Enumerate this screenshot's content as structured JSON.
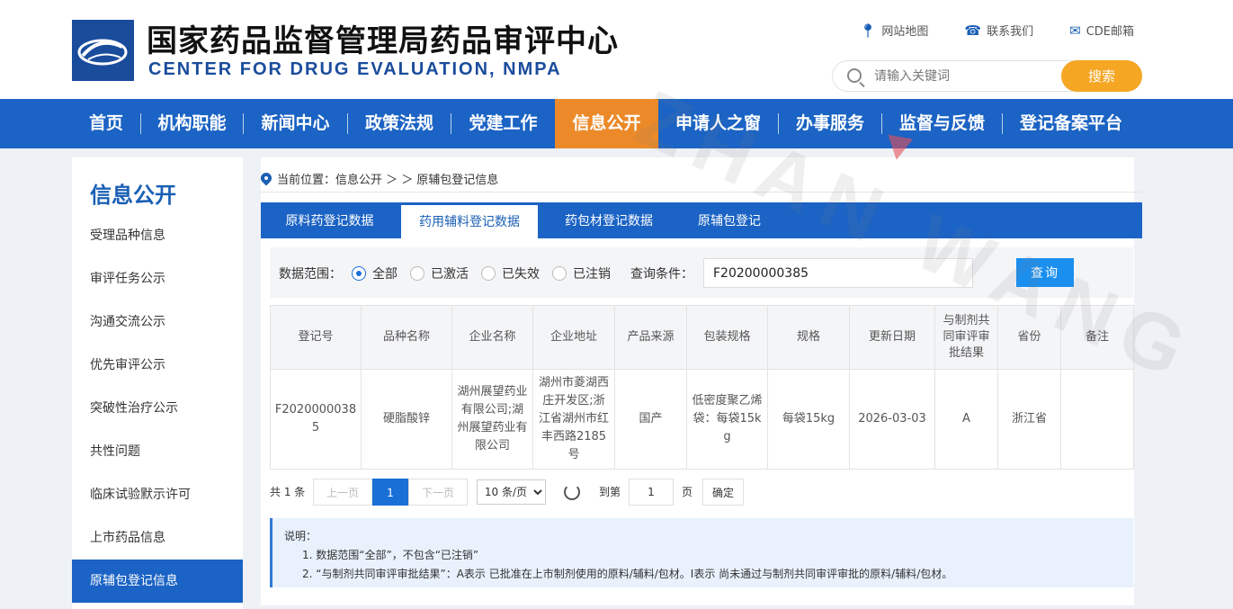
{
  "header": {
    "title_cn": "国家药品监督管理局药品审评中心",
    "title_en": "CENTER FOR DRUG EVALUATION, NMPA",
    "top_links": [
      "网站地图",
      "联系我们",
      "CDE邮箱"
    ],
    "search_placeholder": "请输入关键词",
    "search_button": "搜索"
  },
  "nav": {
    "items": [
      "首页",
      "机构职能",
      "新闻中心",
      "政策法规",
      "党建工作",
      "信息公开",
      "申请人之窗",
      "办事服务",
      "监督与反馈",
      "登记备案平台"
    ],
    "active": "信息公开"
  },
  "watermark": "ZHAN WANG",
  "sidebar": {
    "title": "信息公开",
    "items": [
      "受理品种信息",
      "审评任务公示",
      "沟通交流公示",
      "优先审评公示",
      "突破性治疗公示",
      "共性问题",
      "临床试验默示许可",
      "上市药品信息",
      "原辅包登记信息"
    ],
    "active": "原辅包登记信息"
  },
  "breadcrumb": {
    "prefix": "当前位置：信息公开 ＞ ＞ ",
    "current": "原辅包登记信息"
  },
  "tabs": {
    "items": [
      "原料药登记数据",
      "药用辅料登记数据",
      "药包材登记数据",
      "原辅包登记"
    ],
    "active": "药用辅料登记数据"
  },
  "filter": {
    "range_label": "数据范围：",
    "options": [
      "全部",
      "已激活",
      "已失效",
      "已注销"
    ],
    "selected": "全部",
    "query_label": "查询条件：",
    "query_value": "F20200000385",
    "query_button": "查询"
  },
  "table": {
    "columns": [
      "登记号",
      "品种名称",
      "企业名称",
      "企业地址",
      "产品来源",
      "包装规格",
      "规格",
      "更新日期",
      "与制剂共同审评审批结果",
      "省份",
      "备注"
    ],
    "rows": [
      [
        "F20200000385",
        "硬脂酸锌",
        "湖州展望药业有限公司;湖州展望药业有限公司",
        "湖州市菱湖西庄开发区;浙江省湖州市红丰西路2185号",
        "国产",
        "低密度聚乙烯袋：每袋15kg",
        "每袋15kg",
        "2026-03-03",
        "A",
        "浙江省",
        ""
      ]
    ]
  },
  "pager": {
    "total": "共 1 条",
    "prev": "上一页",
    "current_page": "1",
    "next": "下一页",
    "page_size": "10 条/页",
    "goto_label": "到第",
    "goto_value": "1",
    "page_unit": "页",
    "confirm": "确定"
  },
  "notes": {
    "title": "说明：",
    "lines": [
      "1. 数据范围“全部”，不包含“已注销”",
      "2. “与制剂共同审评审批结果”：A表示 已批准在上市制剂使用的原料/辅料/包材。I表示 尚未通过与制剂共同审评审批的原料/辅料/包材。"
    ]
  },
  "colors": {
    "brand_blue": "#1b63c4",
    "nav_active": "#ec8a2a",
    "search_button": "#f5a623",
    "query_button": "#1a8ff0"
  }
}
